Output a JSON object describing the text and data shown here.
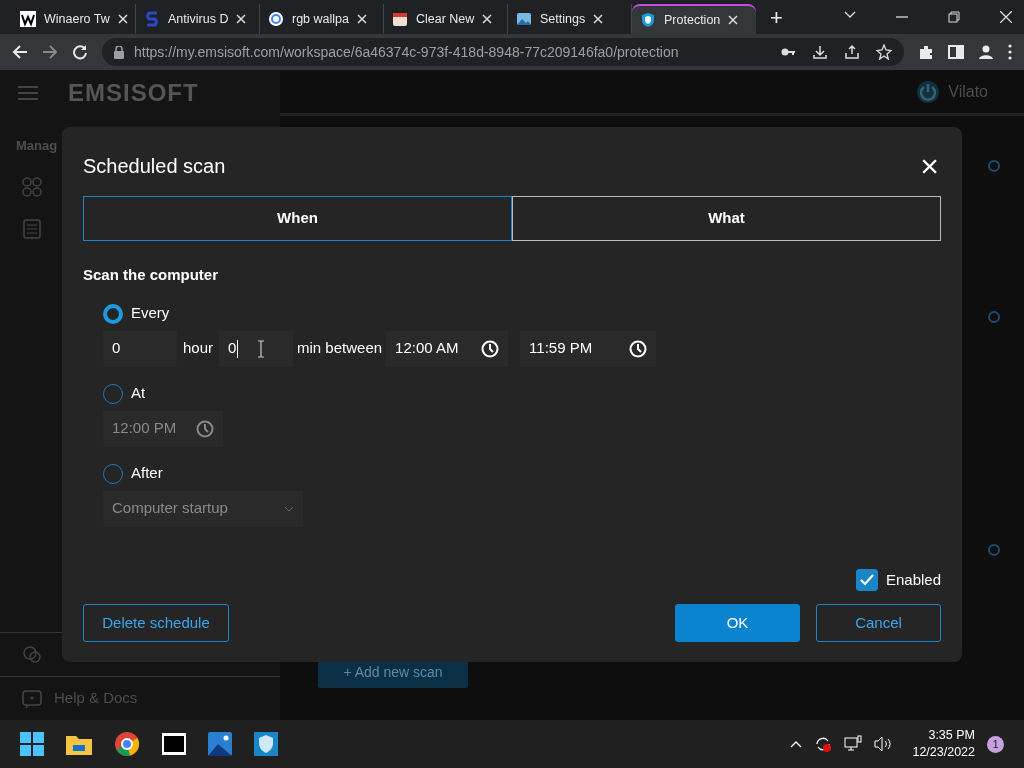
{
  "browser": {
    "tabs": [
      {
        "title": "Winaero Tw",
        "selected": false
      },
      {
        "title": "Antivirus D",
        "selected": false
      },
      {
        "title": "rgb wallpa",
        "selected": false
      },
      {
        "title": "Clear New",
        "selected": false
      },
      {
        "title": "Settings",
        "selected": false
      },
      {
        "title": "Protection",
        "selected": true
      }
    ],
    "new_tab": "+",
    "url": "https://my.emsisoft.com/workspace/6a46374c-973f-418d-8948-77c209146fa0/protection"
  },
  "page": {
    "logo": "EMSISOFT",
    "user": "Vilato",
    "sidebar_heading": "Manag",
    "sidebar_footer": "Help & Docs",
    "add_button": "+ Add new scan"
  },
  "dialog": {
    "title": "Scheduled scan",
    "close": "×",
    "tabs": [
      {
        "label": "When",
        "selected": true
      },
      {
        "label": "What",
        "selected": false
      }
    ],
    "section": "Scan the computer",
    "options": [
      {
        "kind": "interval",
        "label": "Every",
        "selected": true,
        "hours": "0",
        "hour_label": "hour",
        "minutes": "0",
        "min_label": "min between",
        "from": "12:00 AM",
        "to": "11:59 PM"
      },
      {
        "kind": "time",
        "label": "At",
        "selected": false,
        "time": "12:00 PM"
      },
      {
        "kind": "event",
        "label": "After",
        "selected": false,
        "event": "Computer startup"
      }
    ],
    "enabled": {
      "label": "Enabled",
      "checked": true
    },
    "buttons": [
      {
        "label": "Delete schedule",
        "kind": "outline"
      },
      {
        "label": "OK",
        "kind": "primary"
      },
      {
        "label": "Cancel",
        "kind": "outline"
      }
    ]
  },
  "taskbar": {
    "time": "3:35 PM",
    "date": "12/23/2022",
    "notifications": "1"
  }
}
